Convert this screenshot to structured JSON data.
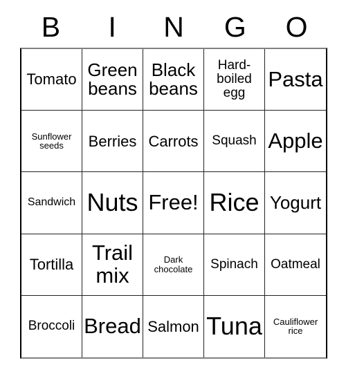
{
  "card": {
    "title": "BINGO",
    "header_letters": [
      "B",
      "I",
      "N",
      "G",
      "O"
    ],
    "free_space_label": "Free!",
    "colors": {
      "text": "#000000",
      "background": "#ffffff",
      "grid_line": "#222222",
      "outer_border": "#000000"
    },
    "grid": {
      "rows": 5,
      "columns": 5,
      "cells": [
        {
          "text": "Tomato",
          "size": "lg"
        },
        {
          "text": "Green beans",
          "size": "xl"
        },
        {
          "text": "Black beans",
          "size": "xl"
        },
        {
          "text": "Hard-boiled egg",
          "size": "md"
        },
        {
          "text": "Pasta",
          "size": "xxl"
        },
        {
          "text": "Sunflower seeds",
          "size": "xs"
        },
        {
          "text": "Berries",
          "size": "lg"
        },
        {
          "text": "Carrots",
          "size": "lg"
        },
        {
          "text": "Squash",
          "size": "md"
        },
        {
          "text": "Apple",
          "size": "xxl"
        },
        {
          "text": "Sandwich",
          "size": "sm"
        },
        {
          "text": "Nuts",
          "size": "huge"
        },
        {
          "text": "Free!",
          "size": "xxl"
        },
        {
          "text": "Rice",
          "size": "huge"
        },
        {
          "text": "Yogurt",
          "size": "xl"
        },
        {
          "text": "Tortilla",
          "size": "lg"
        },
        {
          "text": "Trail mix",
          "size": "xxl"
        },
        {
          "text": "Dark chocolate",
          "size": "xs"
        },
        {
          "text": "Spinach",
          "size": "md"
        },
        {
          "text": "Oatmeal",
          "size": "md"
        },
        {
          "text": "Broccoli",
          "size": "md"
        },
        {
          "text": "Bread",
          "size": "xxl"
        },
        {
          "text": "Salmon",
          "size": "lg"
        },
        {
          "text": "Tuna",
          "size": "huge"
        },
        {
          "text": "Cauliflower rice",
          "size": "xs"
        }
      ]
    }
  }
}
